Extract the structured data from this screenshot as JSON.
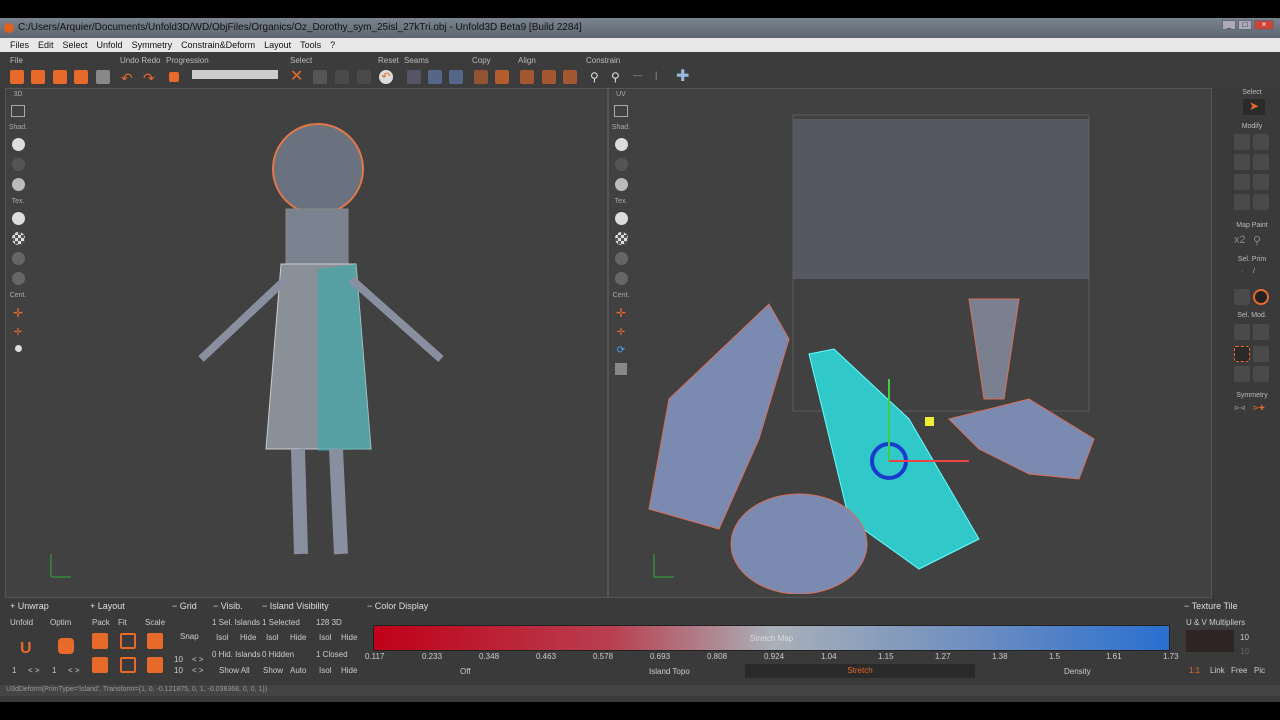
{
  "window": {
    "title": "C:/Users/Arquier/Documents/Unfold3D/WD/ObjFiles/Organics/Oz_Dorothy_sym_25isl_27kTri.obj - Unfold3D Beta9 [Build 2284]"
  },
  "menu": [
    "Files",
    "Edit",
    "Select",
    "Unfold",
    "Symmetry",
    "Constrain&Deform",
    "Layout",
    "Tools",
    "?"
  ],
  "toolbar": {
    "groups": [
      "File",
      "Undo Redo",
      "Progression",
      "Select",
      "Reset",
      "Seams",
      "Copy",
      "Align",
      "Constrain"
    ],
    "progress": 0
  },
  "viewport3d": {
    "label": "3D",
    "side": [
      "Shad.",
      "Tex.",
      "Cent."
    ]
  },
  "viewportUV": {
    "label": "UV",
    "side": [
      "Shad.",
      "Tex.",
      "Cent."
    ]
  },
  "right_tools": {
    "labels": [
      "Select",
      "Modify",
      "Map Paint",
      "Sel. Prim",
      "Sel. Mod.",
      "Symmetry"
    ],
    "x2": "x2"
  },
  "bottom": {
    "unwrap": {
      "header": "Unwrap",
      "unfold": "Unfold",
      "optim": "Optim",
      "unfold_val": "1",
      "optim_val": "1",
      "arrows": "< >"
    },
    "layout": {
      "header": "Layout",
      "pack": "Pack",
      "fit": "Fit",
      "scale": "Scale"
    },
    "grid": {
      "header": "Grid",
      "snap": "Snap",
      "v1": "10",
      "v2": "10",
      "arrows": "< >"
    },
    "visib": {
      "header": "Visib.",
      "sel_islands": "1 Sel. Islands",
      "isol": "Isol",
      "hide": "Hide",
      "hid_islands": "0 Hid. Islands",
      "show_all": "Show All"
    },
    "island_visibility": {
      "header": "Island Visibility",
      "selected": "1 Selected",
      "hidden": "0 Hidden",
      "show": "Show",
      "auto": "Auto",
      "count3d": "128 3D",
      "closed": "1 Closed",
      "isol": "Isol",
      "hide": "Hide"
    },
    "color_display": {
      "header": "Color Display",
      "map_label": "Stretch Map",
      "ticks": [
        "0.117",
        "0.233",
        "0.348",
        "0.463",
        "0.578",
        "0.693",
        "0.808",
        "0.924",
        "1.04",
        "1.15",
        "1.27",
        "1.38",
        "1.5",
        "1.61",
        "1.73"
      ],
      "modes": [
        "Off",
        "Island Topo",
        "Stretch",
        "Density"
      ],
      "active_mode": "Stretch",
      "colors": {
        "low": "#c00018",
        "mid": "#aab0b8",
        "high": "#2a6fd0"
      }
    },
    "texture_tile": {
      "header": "Texture Tile",
      "multipliers": "U & V Multipliers",
      "u": "10",
      "v": "10",
      "buttons": [
        "1:1",
        "Link",
        "Free",
        "Pic"
      ]
    }
  },
  "status": "U3dDeform(PrimType='Island', Transform={1, 0, -0.121875, 0, 1, -0.038368, 0, 0, 1})"
}
